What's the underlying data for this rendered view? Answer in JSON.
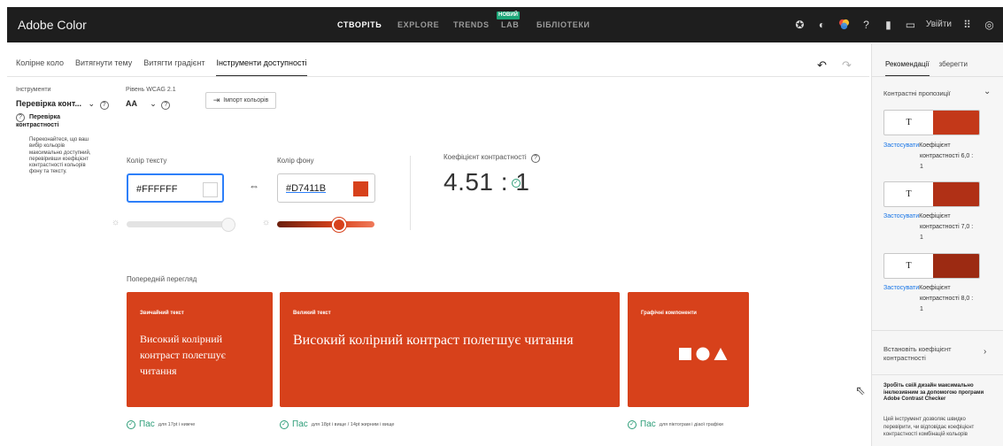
{
  "app": {
    "title": "Adobe Color"
  },
  "topnav": {
    "items": [
      "СТВОРІТЬ",
      "EXPLORE",
      "TRENDS",
      "LAB",
      "БІБЛІОТЕКИ"
    ],
    "new_badge": "НОВИЙ",
    "login_label": "Увійти"
  },
  "tabs": [
    "Колірне коло",
    "Витягнути тему",
    "Витягти градієнт",
    "Інструменти доступності"
  ],
  "tools": {
    "label": "Інструменти",
    "value": "Перевірка конт...",
    "wcag_label": "Рівень WCAG 2.1",
    "wcag_value": "AA",
    "import_label": "Імпорт кольорів",
    "section_title": "Перевірка контрастності",
    "description": "Переконайтеся, що ваш вибір кольорів максимально доступний, перевіривши коефіцієнт контрастності кольорів фону та тексту."
  },
  "text_color": {
    "label": "Колір тексту",
    "value": "#FFFFFF",
    "hex": "#FFFFFF"
  },
  "bg_color": {
    "label": "Колір фону",
    "value": "#D7411B",
    "hex": "#D7411B"
  },
  "contrast": {
    "label": "Коефіцієнт контрастності",
    "value": "4.51 : 1"
  },
  "preview": {
    "title": "Попередній перегляд",
    "cards": [
      {
        "head": "Звичайний текст",
        "text": "Високий колірний контраст полегшує читання"
      },
      {
        "head": "Великий текст",
        "text": "Високий колірний контраст полегшує читання"
      },
      {
        "head": "Графічні компоненти",
        "text": ""
      }
    ],
    "pass": [
      {
        "label": "Пас",
        "detail": "для 17pt і нижче"
      },
      {
        "label": "Пас",
        "detail": "для 18pt і вище / 14pt жирним і вище"
      },
      {
        "label": "Пас",
        "detail": "для піктограм і діаої графіки"
      }
    ]
  },
  "right_panel": {
    "tabs": [
      "Рекомендації",
      "зберегти"
    ],
    "section": "Контрастні пропозиції",
    "suggestions": [
      {
        "letter": "T",
        "color": "#C33819",
        "apply": "Застосувати",
        "ratio_label": "Коефіцієнт",
        "ratio_line": "контрастності 6,0 :",
        "ratio_end": "1"
      },
      {
        "letter": "T",
        "color": "#B03016",
        "apply": "Застосувати",
        "ratio_label": "Коефіцієнт",
        "ratio_line": "контрастності 7,0 :",
        "ratio_end": "1"
      },
      {
        "letter": "T",
        "color": "#9C2A12",
        "apply": "Застосувати",
        "ratio_label": "Коефіцієнт",
        "ratio_line": "контрастності 8,0 :",
        "ratio_end": "1"
      }
    ],
    "set_ratio": "Встановіть коефіцієнт контрастності",
    "promo_bold": "Зробіть свій дизайн максимально інклюзивним за допомогою програми Adobe Contrast Checker",
    "promo_text": "Цей інструмент дозволяє швидко перевірити, чи відповідає коефіцієнт контрастності комбінацій кольорів"
  },
  "colors": {
    "accent": "#D7411B",
    "link": "#1473E6",
    "pass": "#2D9D78"
  }
}
